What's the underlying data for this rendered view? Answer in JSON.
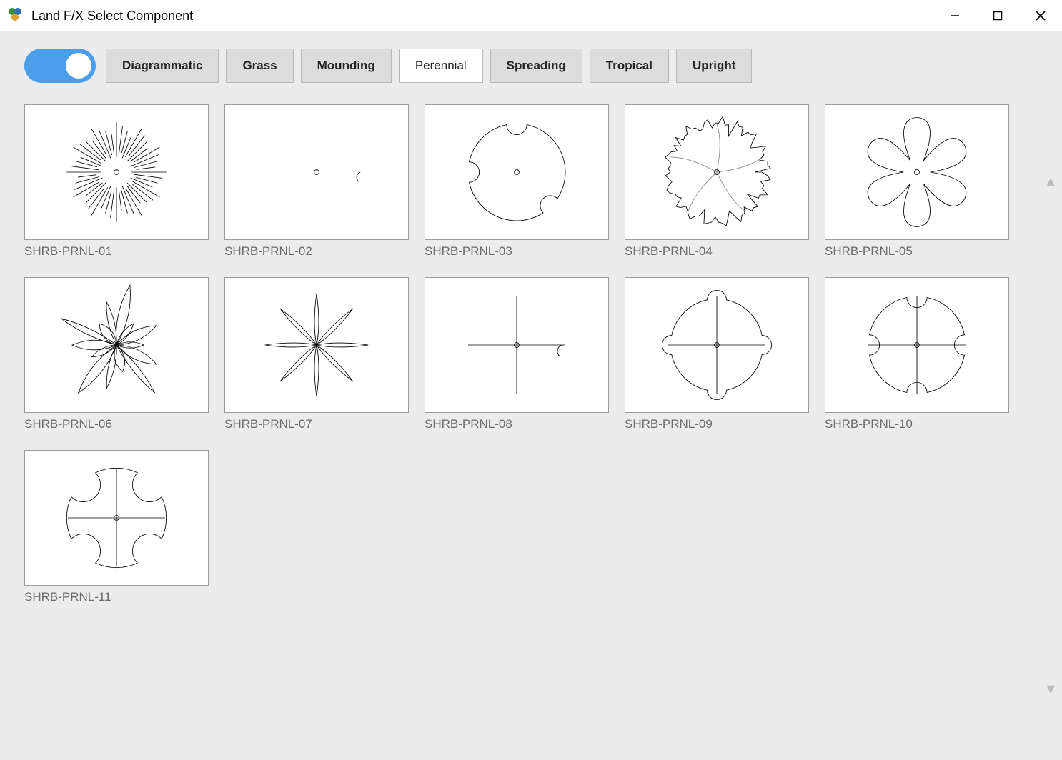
{
  "window": {
    "title": "Land F/X Select Component"
  },
  "toggle": {
    "state": "on"
  },
  "tabs": [
    {
      "label": "Diagrammatic",
      "active": false
    },
    {
      "label": "Grass",
      "active": false
    },
    {
      "label": "Mounding",
      "active": false
    },
    {
      "label": "Perennial",
      "active": true
    },
    {
      "label": "Spreading",
      "active": false
    },
    {
      "label": "Tropical",
      "active": false
    },
    {
      "label": "Upright",
      "active": false
    }
  ],
  "components": [
    {
      "id": "SHRB-PRNL-01",
      "icon": "radial-lines"
    },
    {
      "id": "SHRB-PRNL-02",
      "icon": "scalloped-circle"
    },
    {
      "id": "SHRB-PRNL-03",
      "icon": "circle-3notch"
    },
    {
      "id": "SHRB-PRNL-04",
      "icon": "leaf-5sector"
    },
    {
      "id": "SHRB-PRNL-05",
      "icon": "flower-6petal"
    },
    {
      "id": "SHRB-PRNL-06",
      "icon": "multi-leaf"
    },
    {
      "id": "SHRB-PRNL-07",
      "icon": "star-8blade"
    },
    {
      "id": "SHRB-PRNL-08",
      "icon": "scalloped-cross"
    },
    {
      "id": "SHRB-PRNL-09",
      "icon": "circle-4bump-cross"
    },
    {
      "id": "SHRB-PRNL-10",
      "icon": "circle-4notch-cross"
    },
    {
      "id": "SHRB-PRNL-11",
      "icon": "quad-lobe-cross"
    }
  ]
}
